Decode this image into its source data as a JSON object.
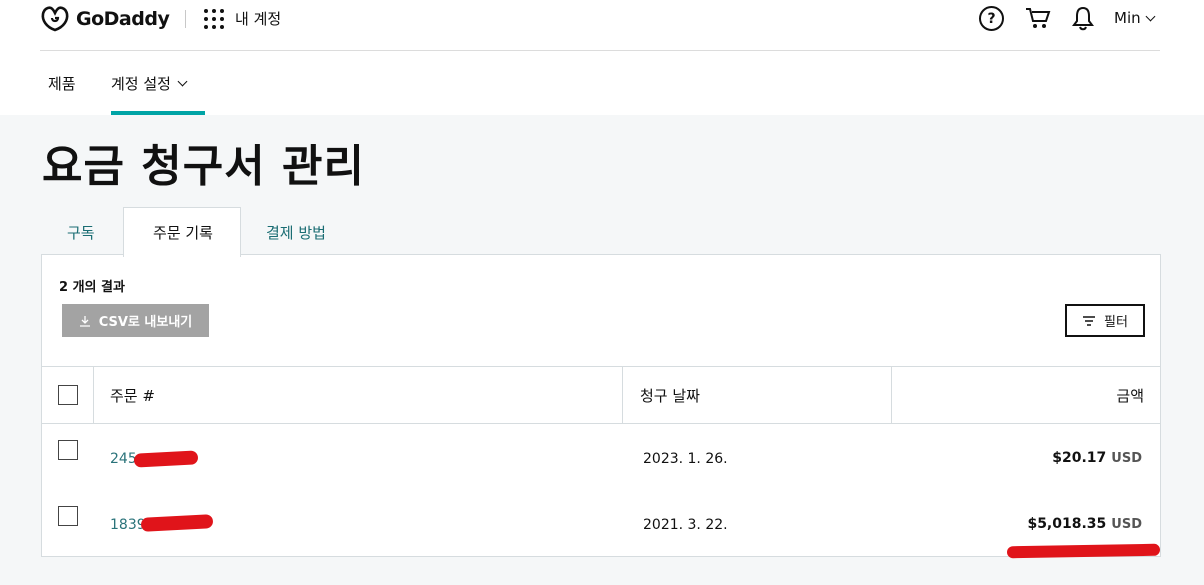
{
  "header": {
    "brand": "GoDaddy",
    "my_account": "내 계정",
    "user": "Min"
  },
  "nav": {
    "products": "제품",
    "account_settings": "계정 설정"
  },
  "page": {
    "title": "요금 청구서 관리"
  },
  "tabs": [
    {
      "label": "구독",
      "active": false
    },
    {
      "label": "주문 기록",
      "active": true
    },
    {
      "label": "결제 방법",
      "active": false
    }
  ],
  "results": {
    "count_text": "2 개의 결과",
    "export_label": "CSV로 내보내기",
    "filter_label": "필터"
  },
  "table": {
    "headers": {
      "order": "주문 #",
      "date": "청구 날짜",
      "amount": "금액"
    },
    "rows": [
      {
        "order": "245",
        "date": "2023. 1. 26.",
        "amount": "$20.17",
        "currency": "USD"
      },
      {
        "order": "1839",
        "date": "2021. 3. 22.",
        "amount": "$5,018.35",
        "currency": "USD"
      }
    ]
  },
  "colors": {
    "accent": "#00a4a6",
    "link": "#2a737a",
    "redaction": "#e0141a"
  }
}
